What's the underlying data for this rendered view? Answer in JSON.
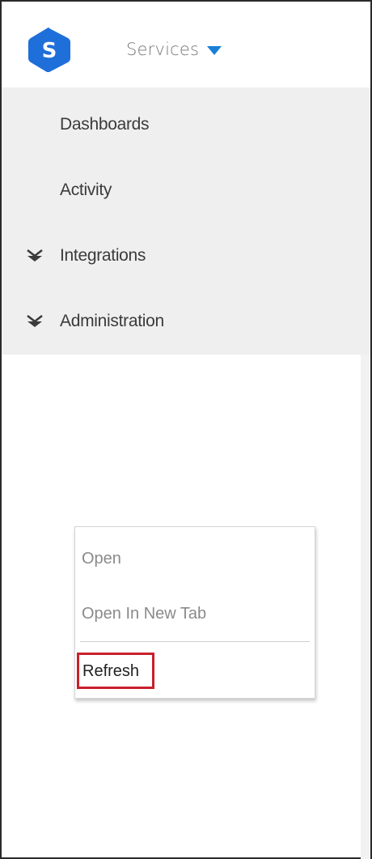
{
  "header": {
    "logo_letter": "S",
    "logo_color": "#1e6fd9",
    "services_label": "Services",
    "services_icon": "caret-down-icon",
    "accent": "#1a7fd6"
  },
  "nav": {
    "items": [
      {
        "label": "Dashboards",
        "icon": null
      },
      {
        "label": "Activity",
        "icon": null
      },
      {
        "label": "Integrations",
        "icon": "double-chevron-down-icon"
      },
      {
        "label": "Administration",
        "icon": "double-chevron-down-icon"
      }
    ]
  },
  "context_menu": {
    "items": [
      {
        "label": "Open"
      },
      {
        "label": "Open In New Tab"
      },
      {
        "label": "Refresh",
        "highlighted": true
      }
    ],
    "highlight_color": "#c8202c"
  }
}
